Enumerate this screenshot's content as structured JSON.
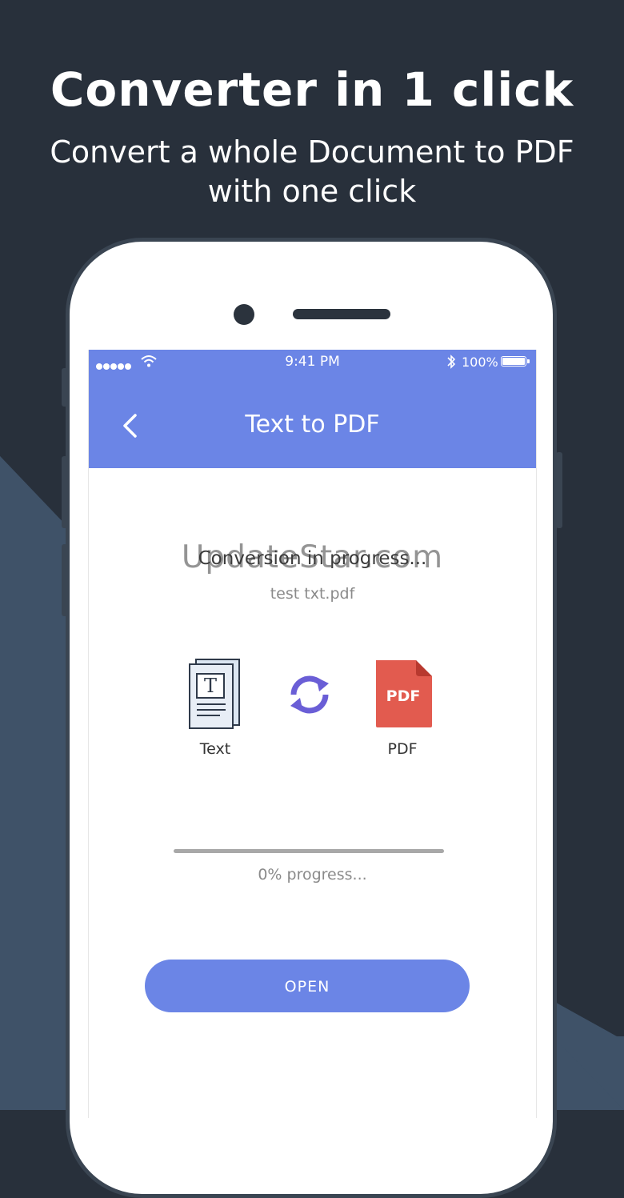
{
  "promo": {
    "headline": "Converter in 1 click",
    "subline": "Convert a whole Document to PDF with one click"
  },
  "status_bar": {
    "time": "9:41 PM",
    "battery": "100%",
    "icons": [
      "signal-icon",
      "wifi-icon",
      "bluetooth-icon",
      "battery-icon"
    ]
  },
  "app_bar": {
    "title": "Text to PDF",
    "back_icon": "chevron-left-icon"
  },
  "conversion": {
    "status": "Conversion in progress...",
    "watermark": "UpdateStar.com",
    "filename": "test txt.pdf",
    "source_label": "Text",
    "target_label": "PDF",
    "pdf_badge": "PDF",
    "doc_badge": "T",
    "progress": 0,
    "progress_text": "0% progress..."
  },
  "actions": {
    "open_label": "OPEN"
  },
  "colors": {
    "background": "#28303b",
    "accent": "#6b85e6",
    "pdf_red": "#e25b4f"
  }
}
